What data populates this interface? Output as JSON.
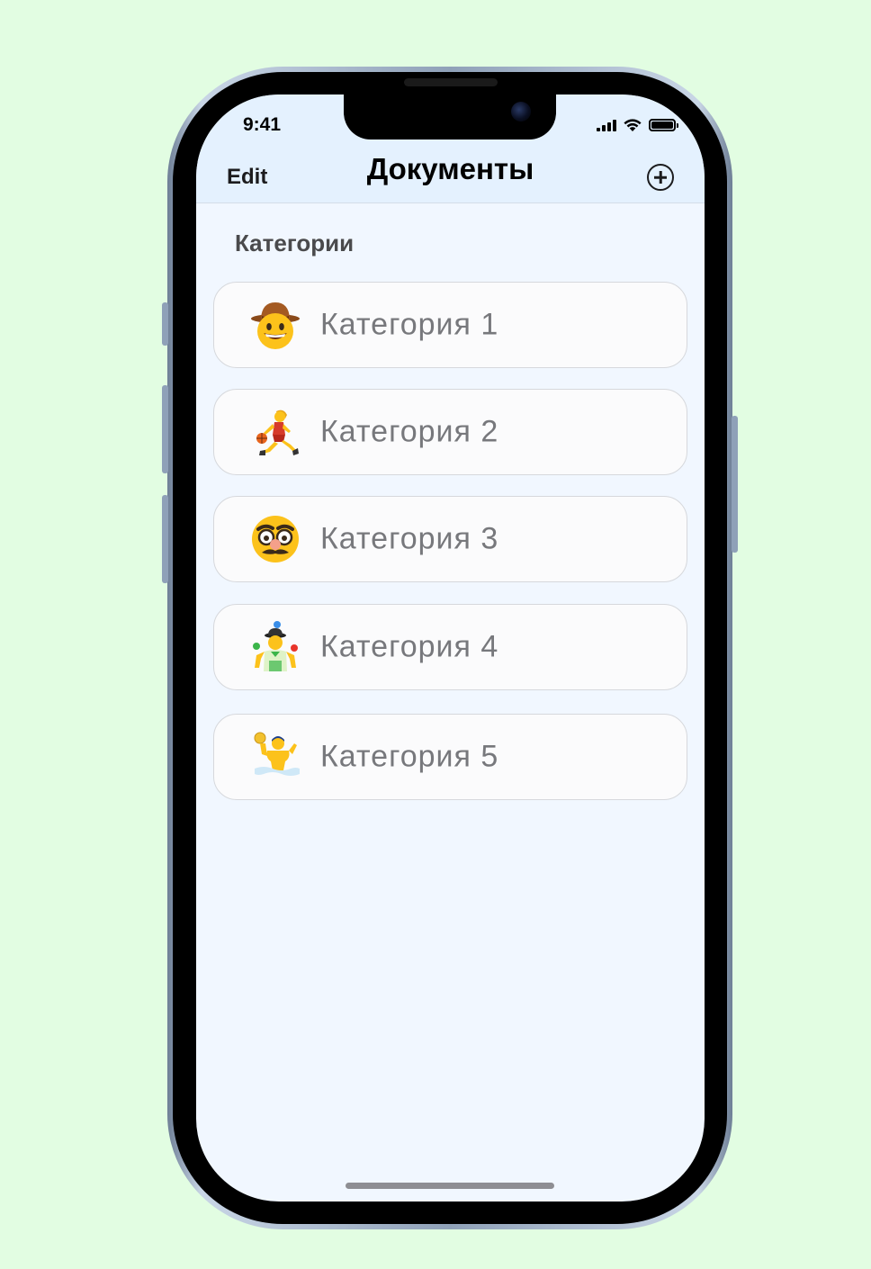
{
  "status_bar": {
    "time": "9:41"
  },
  "navbar": {
    "edit_label": "Edit",
    "title": "Документы",
    "add_icon": "plus-circle-icon"
  },
  "section": {
    "header": "Категории"
  },
  "categories": [
    {
      "label": "Категория 1",
      "icon": "cowboy-face-icon"
    },
    {
      "label": "Категория 2",
      "icon": "basketball-player-icon"
    },
    {
      "label": "Категория 3",
      "icon": "disguised-face-icon"
    },
    {
      "label": "Категория 4",
      "icon": "juggler-icon"
    },
    {
      "label": "Категория 5",
      "icon": "water-polo-player-icon"
    }
  ],
  "colors": {
    "background": "#e2fde2",
    "screen": "#f1f7ff",
    "navbar": "#e4f1fe",
    "label": "#77787c"
  }
}
